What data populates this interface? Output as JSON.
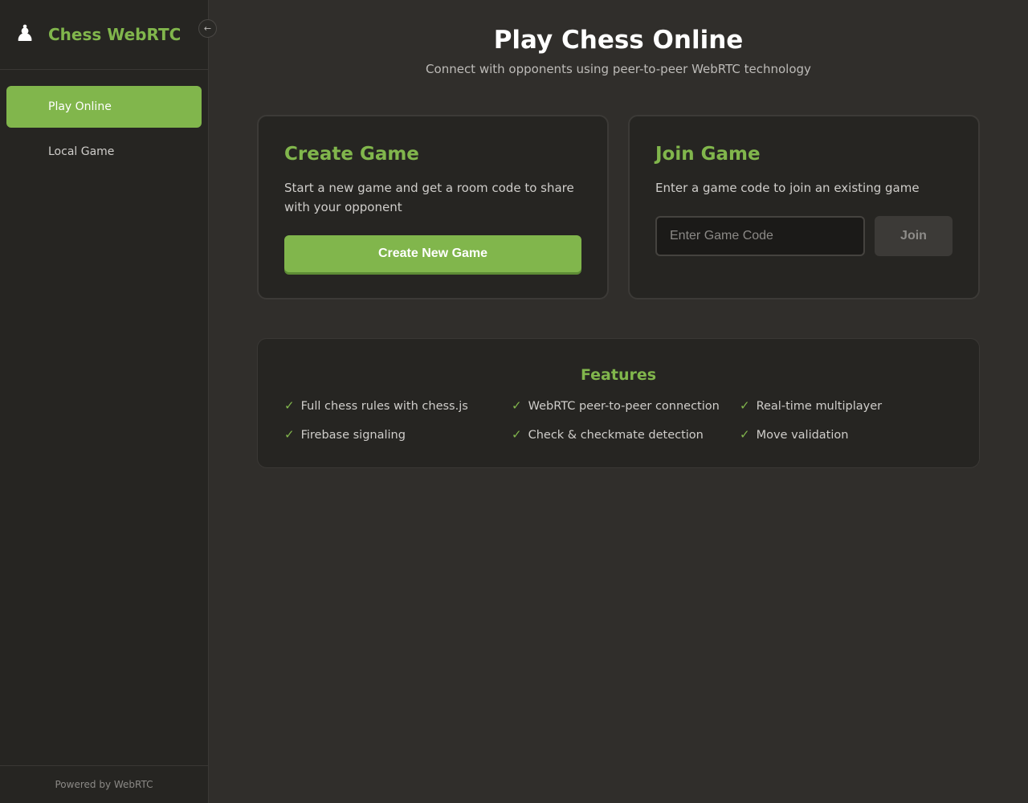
{
  "sidebar": {
    "logo_icon": "♟",
    "brand": "Chess WebRTC",
    "collapse_icon": "←",
    "items": [
      {
        "icon": "",
        "label": "Play Online",
        "active": true
      },
      {
        "icon": "",
        "label": "Local Game",
        "active": false
      }
    ],
    "footer": "Powered by WebRTC"
  },
  "header": {
    "title_icon": "",
    "title": "Play Chess Online",
    "subtitle": "Connect with opponents using peer-to-peer WebRTC technology"
  },
  "create_card": {
    "icon": "",
    "title": "Create Game",
    "description": "Start a new game and get a room code to share with your opponent",
    "button_label": "Create New Game"
  },
  "join_card": {
    "icon": "",
    "title": "Join Game",
    "description": "Enter a game code to join an existing game",
    "input_value": "",
    "input_placeholder": "Enter Game Code",
    "button_label": "Join"
  },
  "features": {
    "icon": "",
    "title": "Features",
    "check_glyph": "✓",
    "items": [
      "Full chess rules with chess.js",
      "WebRTC peer-to-peer connection",
      "Real-time multiplayer",
      "Firebase signaling",
      "Check & checkmate detection",
      "Move validation"
    ]
  },
  "colors": {
    "accent": "#81b64c",
    "background": "#302e2b",
    "sidebar": "#262522"
  }
}
